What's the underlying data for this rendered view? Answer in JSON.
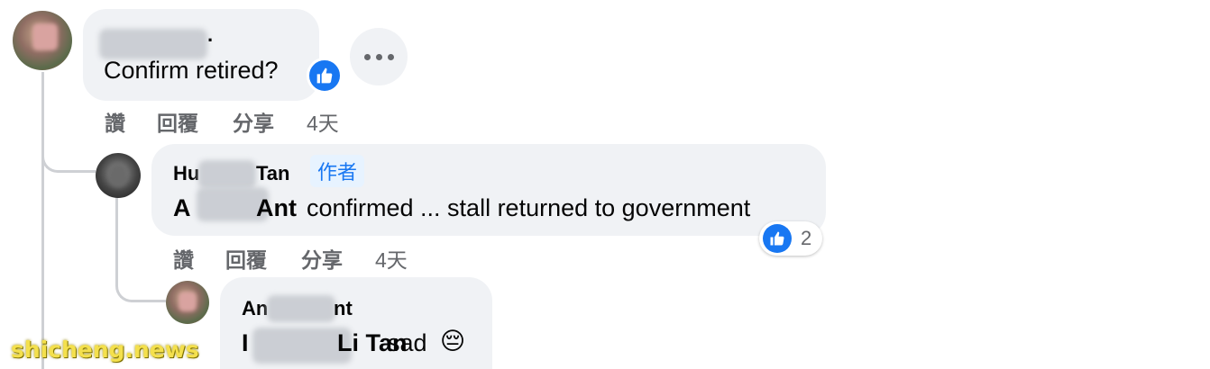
{
  "comment1": {
    "name": "·",
    "text": "Confirm retired?",
    "actions": {
      "like": "讚",
      "reply": "回覆",
      "share": "分享"
    },
    "time": "4天"
  },
  "comment2": {
    "name_prefix": "Hu",
    "name_suffix": "Tan",
    "author_label": "作者",
    "mention_start": "A",
    "mention_end": "Ant",
    "text": "confirmed ... stall returned to government",
    "reaction_count": "2",
    "actions": {
      "like": "讚",
      "reply": "回覆",
      "share": "分享"
    },
    "time": "4天"
  },
  "comment3": {
    "name_prefix": "An",
    "name_suffix": "nt",
    "mention_start": "I",
    "mention_end": "Li Tan",
    "text": "sad",
    "emoji": "😔"
  },
  "watermark": "shicheng.news",
  "colors": {
    "accent": "#1877f2",
    "bubble": "#f0f2f5",
    "meta": "#65676b"
  }
}
